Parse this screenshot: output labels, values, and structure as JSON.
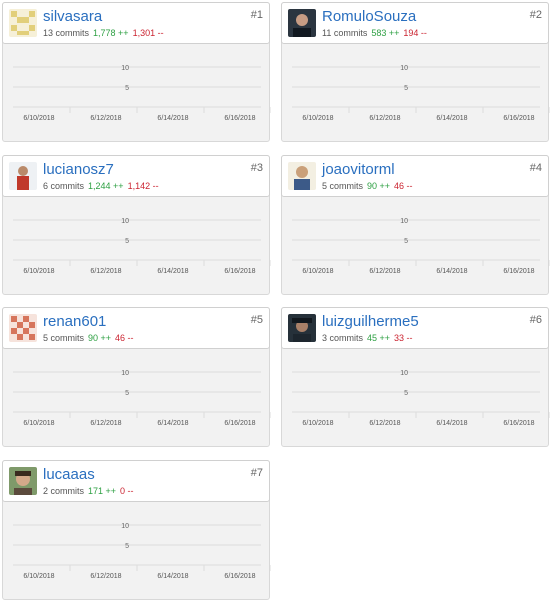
{
  "axis": {
    "y_ticks": [
      "10",
      "5"
    ],
    "x_ticks": [
      "6/10/2018",
      "6/12/2018",
      "6/14/2018",
      "6/16/2018"
    ]
  },
  "colors": {
    "link": "#2a6fbf",
    "additions": "#2ea043",
    "deletions": "#cb2431"
  },
  "contributors": [
    {
      "rank": "#1",
      "username": "silvasara",
      "commits": "13 commits",
      "additions": "1,778 ++",
      "deletions": "1,301 --",
      "avatar_icon": "identicon-yellow"
    },
    {
      "rank": "#2",
      "username": "RomuloSouza",
      "commits": "11 commits",
      "additions": "583 ++",
      "deletions": "194 --",
      "avatar_icon": "photo-avatar"
    },
    {
      "rank": "#3",
      "username": "lucianosz7",
      "commits": "6 commits",
      "additions": "1,244 ++",
      "deletions": "1,142 --",
      "avatar_icon": "photo-avatar"
    },
    {
      "rank": "#4",
      "username": "joaovitorml",
      "commits": "5 commits",
      "additions": "90 ++",
      "deletions": "46 --",
      "avatar_icon": "photo-avatar"
    },
    {
      "rank": "#5",
      "username": "renan601",
      "commits": "5 commits",
      "additions": "90 ++",
      "deletions": "46 --",
      "avatar_icon": "identicon-red"
    },
    {
      "rank": "#6",
      "username": "luizguilherme5",
      "commits": "3 commits",
      "additions": "45 ++",
      "deletions": "33 --",
      "avatar_icon": "photo-avatar"
    },
    {
      "rank": "#7",
      "username": "lucaaas",
      "commits": "2 commits",
      "additions": "171 ++",
      "deletions": "0 --",
      "avatar_icon": "photo-avatar"
    }
  ]
}
